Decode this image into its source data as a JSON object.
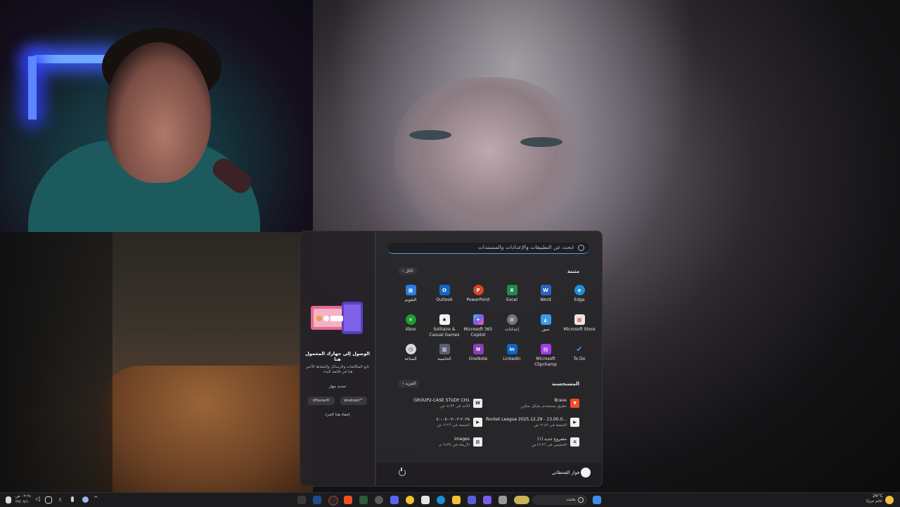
{
  "search": {
    "placeholder": "ابحث عن التطبيقات والإعدادات والمستندات"
  },
  "pinned": {
    "title": "مثبتة",
    "all_label": "الكل",
    "apps": [
      {
        "label": "Edge",
        "icon": "edge-icon",
        "color": "#1c8fd8"
      },
      {
        "label": "Word",
        "icon": "word-icon",
        "color": "#2b63c6"
      },
      {
        "label": "Excel",
        "icon": "excel-icon",
        "color": "#1e8a4c"
      },
      {
        "label": "PowerPoint",
        "icon": "powerpoint-icon",
        "color": "#d24726"
      },
      {
        "label": "Outlook",
        "icon": "outlook-icon",
        "color": "#1467c4"
      },
      {
        "label": "التقويم",
        "icon": "calendar-icon",
        "color": "#2b7de0"
      },
      {
        "label": "Microsoft Store",
        "icon": "store-icon",
        "color": "#e6e6e6"
      },
      {
        "label": "صور",
        "icon": "photos-icon",
        "color": "#3b9be8"
      },
      {
        "label": "إعدادات",
        "icon": "settings-icon",
        "color": "#6f7581"
      },
      {
        "label": "Microsoft 365 Copilot",
        "icon": "copilot-icon",
        "color": "#7b5ce6"
      },
      {
        "label": "Solitaire & Casual Games",
        "icon": "solitaire-icon",
        "color": "#f2f2f2"
      },
      {
        "label": "Xbox",
        "icon": "xbox-icon",
        "color": "#1f9b32"
      },
      {
        "label": "To Do",
        "icon": "todo-icon",
        "color": "#2f6fe0"
      },
      {
        "label": "Microsoft Clipchamp",
        "icon": "clipchamp-icon",
        "color": "#a43ee0"
      },
      {
        "label": "LinkedIn",
        "icon": "linkedin-icon",
        "color": "#0a66c2"
      },
      {
        "label": "OneNote",
        "icon": "onenote-icon",
        "color": "#8a3fb7"
      },
      {
        "label": "الحاسبة",
        "icon": "calculator-icon",
        "color": "#5a6172"
      },
      {
        "label": "الساعة",
        "icon": "clock-icon",
        "color": "#d8d8d8"
      }
    ]
  },
  "recommended": {
    "title": "المستحسنة",
    "more_label": "المزيد",
    "items": [
      {
        "name": "Brave",
        "sub": "تطبيق مستخدم بشكل متكرر",
        "icon": "brave-icon",
        "color": "#f04e23"
      },
      {
        "name": "GROUP2-CASE STUDY CH1",
        "sub": "الأحد في ٠٤:٣٢ص",
        "icon": "word-doc-icon",
        "color": "#e8eef8"
      },
      {
        "name": "Rocket League 2025.12.29 - 13.00.0...",
        "sub": "الجمعة في ٠٢:٤٧ص",
        "icon": "video-file-icon",
        "color": "#f0f0f0"
      },
      {
        "name": "٢٠٢٥-٠٢-٠٢-٠٤-٤٠",
        "sub": "الجمعة في ٠٢:٢٦ص",
        "icon": "video-file-icon",
        "color": "#f0f0f0"
      },
      {
        "name": "مشروع جديد (١)",
        "sub": "الخميس في ١٢:٢٦ص",
        "icon": "document-icon",
        "color": "#e8eef8"
      },
      {
        "name": "images",
        "sub": "الأربعاء في ٠٩:٣٧م",
        "icon": "image-file-icon",
        "color": "#e8eef8"
      }
    ]
  },
  "user": {
    "name": "فواز القحطاني"
  },
  "phone_panel": {
    "title": "الوصول إلى جهازك المحمول هنا",
    "description": "تابع المكالمات والرسائل والنشاط الأخير هنا في قائمة البدء.",
    "select_device": "تحديد جهاز",
    "iphone": "iPhone®",
    "android": "Android™",
    "hide": "إخفاء هذا الجزء"
  },
  "taskbar": {
    "search_placeholder": "بحث",
    "weather_temp": "26°C",
    "weather_desc": "غائم جزئيًا",
    "time": "٠٢:٢٤ ص",
    "date": "٢٧/٠٧/١٠",
    "lang": "ع"
  }
}
